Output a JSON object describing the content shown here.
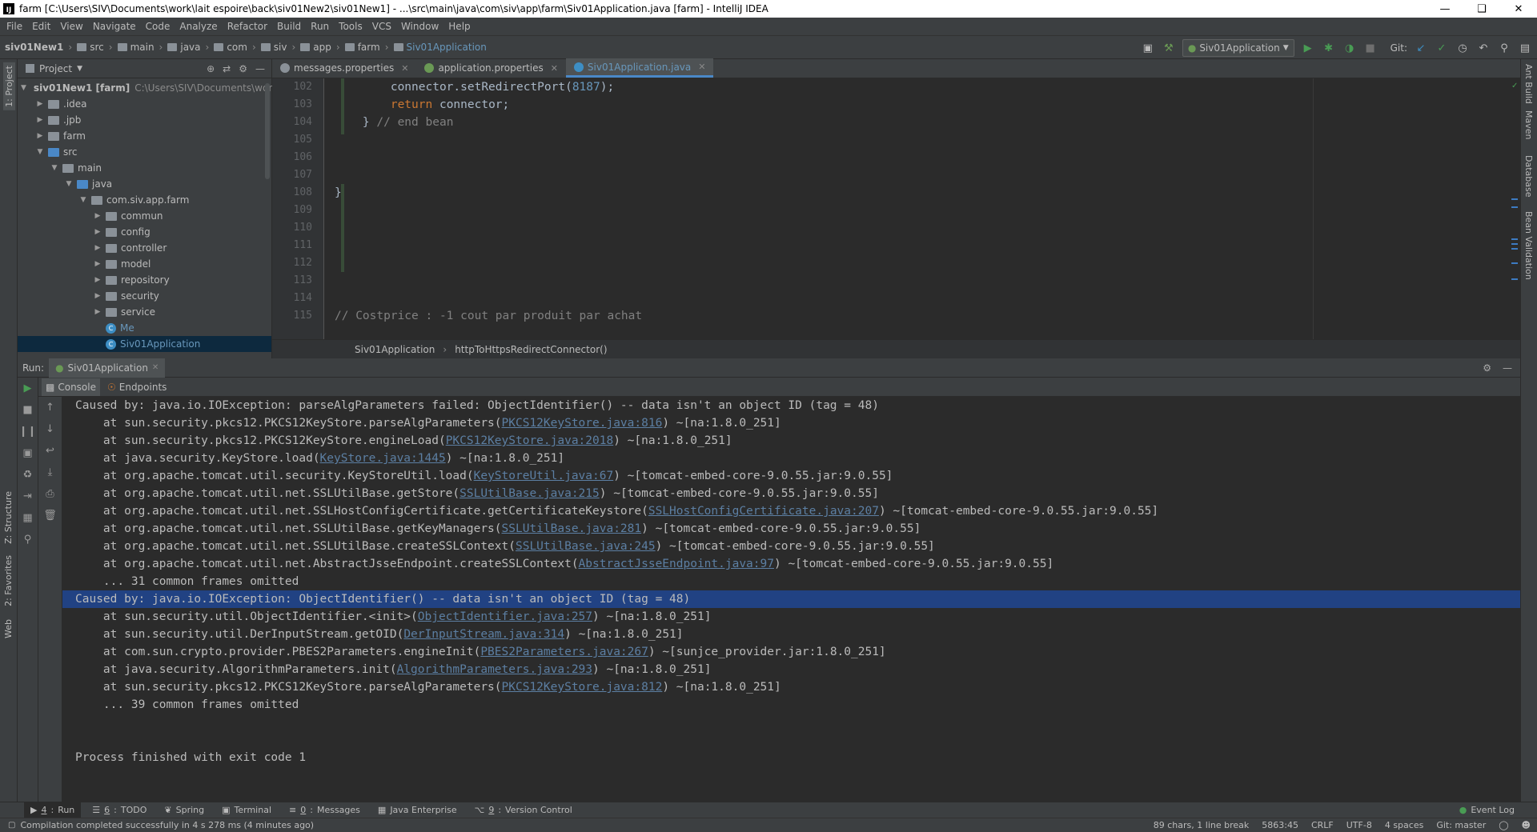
{
  "window": {
    "title": "farm [C:\\Users\\SIV\\Documents\\work\\lait espoire\\back\\siv01New2\\siv01New1] - ...\\src\\main\\java\\com\\siv\\app\\farm\\Siv01Application.java [farm] - IntelliJ IDEA"
  },
  "menu": [
    "File",
    "Edit",
    "View",
    "Navigate",
    "Code",
    "Analyze",
    "Refactor",
    "Build",
    "Run",
    "Tools",
    "VCS",
    "Window",
    "Help"
  ],
  "breadcrumbs": [
    "siv01New1",
    "src",
    "main",
    "java",
    "com",
    "siv",
    "app",
    "farm",
    "Siv01Application"
  ],
  "toolbar": {
    "run_config": "Siv01Application",
    "git_label": "Git:"
  },
  "left_strip": {
    "project": "1: Project",
    "structure": "Z: Structure",
    "favorites": "2: Favorites",
    "web": "Web"
  },
  "right_strip": [
    "Ant Build",
    "Maven",
    "Database",
    "Bean Validation"
  ],
  "project": {
    "header": "Project",
    "tree": [
      {
        "label": "siv01New1 [farm]",
        "detail": "C:\\Users\\SIV\\Documents\\work\\lai",
        "depth": 0,
        "expanded": true,
        "type": "module"
      },
      {
        "label": ".idea",
        "depth": 1,
        "expanded": false,
        "type": "folder"
      },
      {
        "label": ".jpb",
        "depth": 1,
        "expanded": false,
        "type": "folder"
      },
      {
        "label": "farm",
        "depth": 1,
        "expanded": false,
        "type": "folder"
      },
      {
        "label": "src",
        "depth": 1,
        "expanded": true,
        "type": "folder"
      },
      {
        "label": "main",
        "depth": 2,
        "expanded": true,
        "type": "folder"
      },
      {
        "label": "java",
        "depth": 3,
        "expanded": true,
        "type": "folder"
      },
      {
        "label": "com.siv.app.farm",
        "depth": 4,
        "expanded": true,
        "type": "package"
      },
      {
        "label": "commun",
        "depth": 5,
        "expanded": false,
        "type": "package"
      },
      {
        "label": "config",
        "depth": 5,
        "expanded": false,
        "type": "package"
      },
      {
        "label": "controller",
        "depth": 5,
        "expanded": false,
        "type": "package"
      },
      {
        "label": "model",
        "depth": 5,
        "expanded": false,
        "type": "package"
      },
      {
        "label": "repository",
        "depth": 5,
        "expanded": false,
        "type": "package"
      },
      {
        "label": "security",
        "depth": 5,
        "expanded": false,
        "type": "package"
      },
      {
        "label": "service",
        "depth": 5,
        "expanded": false,
        "type": "package"
      },
      {
        "label": "Me",
        "depth": 5,
        "type": "class"
      },
      {
        "label": "Siv01Application",
        "depth": 5,
        "type": "class",
        "selected": true
      }
    ]
  },
  "editor": {
    "tabs": [
      {
        "label": "messages.properties",
        "active": false
      },
      {
        "label": "application.properties",
        "active": false
      },
      {
        "label": "Siv01Application.java",
        "active": true
      }
    ],
    "line_numbers": [
      "102",
      "103",
      "104",
      "105",
      "106",
      "107",
      "108",
      "109",
      "110",
      "111",
      "112",
      "113",
      "114",
      "115"
    ],
    "lines": [
      {
        "indent": "        ",
        "code": "connector.setRedirectPort(",
        "num": "8187",
        "end": ");"
      },
      {
        "indent": "        ",
        "kw": "return",
        "code": " connector;"
      },
      {
        "indent": "    ",
        "code": "} ",
        "comment": "// end bean"
      },
      {
        "indent": "",
        "code": ""
      },
      {
        "indent": "",
        "code": ""
      },
      {
        "indent": "",
        "code": ""
      },
      {
        "indent": "",
        "code": "}"
      },
      {
        "indent": "",
        "code": ""
      },
      {
        "indent": "",
        "code": ""
      },
      {
        "indent": "",
        "code": ""
      },
      {
        "indent": "",
        "code": ""
      },
      {
        "indent": "",
        "code": ""
      },
      {
        "indent": "",
        "code": ""
      },
      {
        "indent": "",
        "comment": "// Costprice : -1 cout par produit par achat"
      }
    ],
    "breadcrumb": [
      "Siv01Application",
      "httpToHttpsRedirectConnector()"
    ]
  },
  "run": {
    "label": "Run:",
    "config_tab": "Siv01Application",
    "subtabs": [
      "Console",
      "Endpoints"
    ],
    "console_lines": [
      {
        "text": "Caused by: java.io.IOException: parseAlgParameters failed: ObjectIdentifier() -- data isn't an object ID (tag = 48)",
        "indent": 0
      },
      {
        "pre": "at sun.security.pkcs12.PKCS12KeyStore.parseAlgParameters(",
        "link": "PKCS12KeyStore.java:816",
        "post": ") ~[na:1.8.0_251]",
        "indent": 1
      },
      {
        "pre": "at sun.security.pkcs12.PKCS12KeyStore.engineLoad(",
        "link": "PKCS12KeyStore.java:2018",
        "post": ") ~[na:1.8.0_251]",
        "indent": 1
      },
      {
        "pre": "at java.security.KeyStore.load(",
        "link": "KeyStore.java:1445",
        "post": ") ~[na:1.8.0_251]",
        "indent": 1
      },
      {
        "pre": "at org.apache.tomcat.util.security.KeyStoreUtil.load(",
        "link": "KeyStoreUtil.java:67",
        "post": ") ~[tomcat-embed-core-9.0.55.jar:9.0.55]",
        "indent": 1
      },
      {
        "pre": "at org.apache.tomcat.util.net.SSLUtilBase.getStore(",
        "link": "SSLUtilBase.java:215",
        "post": ") ~[tomcat-embed-core-9.0.55.jar:9.0.55]",
        "indent": 1
      },
      {
        "pre": "at org.apache.tomcat.util.net.SSLHostConfigCertificate.getCertificateKeystore(",
        "link": "SSLHostConfigCertificate.java:207",
        "post": ") ~[tomcat-embed-core-9.0.55.jar:9.0.55]",
        "indent": 1
      },
      {
        "pre": "at org.apache.tomcat.util.net.SSLUtilBase.getKeyManagers(",
        "link": "SSLUtilBase.java:281",
        "post": ") ~[tomcat-embed-core-9.0.55.jar:9.0.55]",
        "indent": 1
      },
      {
        "pre": "at org.apache.tomcat.util.net.SSLUtilBase.createSSLContext(",
        "link": "SSLUtilBase.java:245",
        "post": ") ~[tomcat-embed-core-9.0.55.jar:9.0.55]",
        "indent": 1
      },
      {
        "pre": "at org.apache.tomcat.util.net.AbstractJsseEndpoint.createSSLContext(",
        "link": "AbstractJsseEndpoint.java:97",
        "post": ") ~[tomcat-embed-core-9.0.55.jar:9.0.55]",
        "indent": 1
      },
      {
        "text": "... 31 common frames omitted",
        "indent": 1
      },
      {
        "text": "Caused by: java.io.IOException: ObjectIdentifier() -- data isn't an object ID (tag = 48)",
        "indent": 0,
        "highlight": true
      },
      {
        "pre": "at sun.security.util.ObjectIdentifier.<init>(",
        "link": "ObjectIdentifier.java:257",
        "post": ") ~[na:1.8.0_251]",
        "indent": 1
      },
      {
        "pre": "at sun.security.util.DerInputStream.getOID(",
        "link": "DerInputStream.java:314",
        "post": ") ~[na:1.8.0_251]",
        "indent": 1
      },
      {
        "pre": "at com.sun.crypto.provider.PBES2Parameters.engineInit(",
        "link": "PBES2Parameters.java:267",
        "post": ") ~[sunjce_provider.jar:1.8.0_251]",
        "indent": 1
      },
      {
        "pre": "at java.security.AlgorithmParameters.init(",
        "link": "AlgorithmParameters.java:293",
        "post": ") ~[na:1.8.0_251]",
        "indent": 1
      },
      {
        "pre": "at sun.security.pkcs12.PKCS12KeyStore.parseAlgParameters(",
        "link": "PKCS12KeyStore.java:812",
        "post": ") ~[na:1.8.0_251]",
        "indent": 1
      },
      {
        "text": "... 39 common frames omitted",
        "indent": 1
      },
      {
        "text": "",
        "indent": 0
      },
      {
        "text": "",
        "indent": 0
      },
      {
        "text": "Process finished with exit code 1",
        "indent": 0
      }
    ]
  },
  "bottom_tabs": [
    {
      "num": "4",
      "label": "Run",
      "active": true
    },
    {
      "num": "6",
      "label": "TODO"
    },
    {
      "num": "",
      "label": "Spring"
    },
    {
      "num": "",
      "label": "Terminal"
    },
    {
      "num": "0",
      "label": "Messages"
    },
    {
      "num": "",
      "label": "Java Enterprise"
    },
    {
      "num": "9",
      "label": "Version Control"
    }
  ],
  "event_log": "Event Log",
  "status": {
    "message": "Compilation completed successfully in 4 s 278 ms (4 minutes ago)",
    "chars": "89 chars, 1 line break",
    "position": "5863:45",
    "line_sep": "CRLF",
    "encoding": "UTF-8",
    "indent": "4 spaces",
    "git": "Git: master"
  },
  "colors": {
    "accent": "#4a88c7",
    "selection": "#214283",
    "run_green": "#499c54"
  }
}
